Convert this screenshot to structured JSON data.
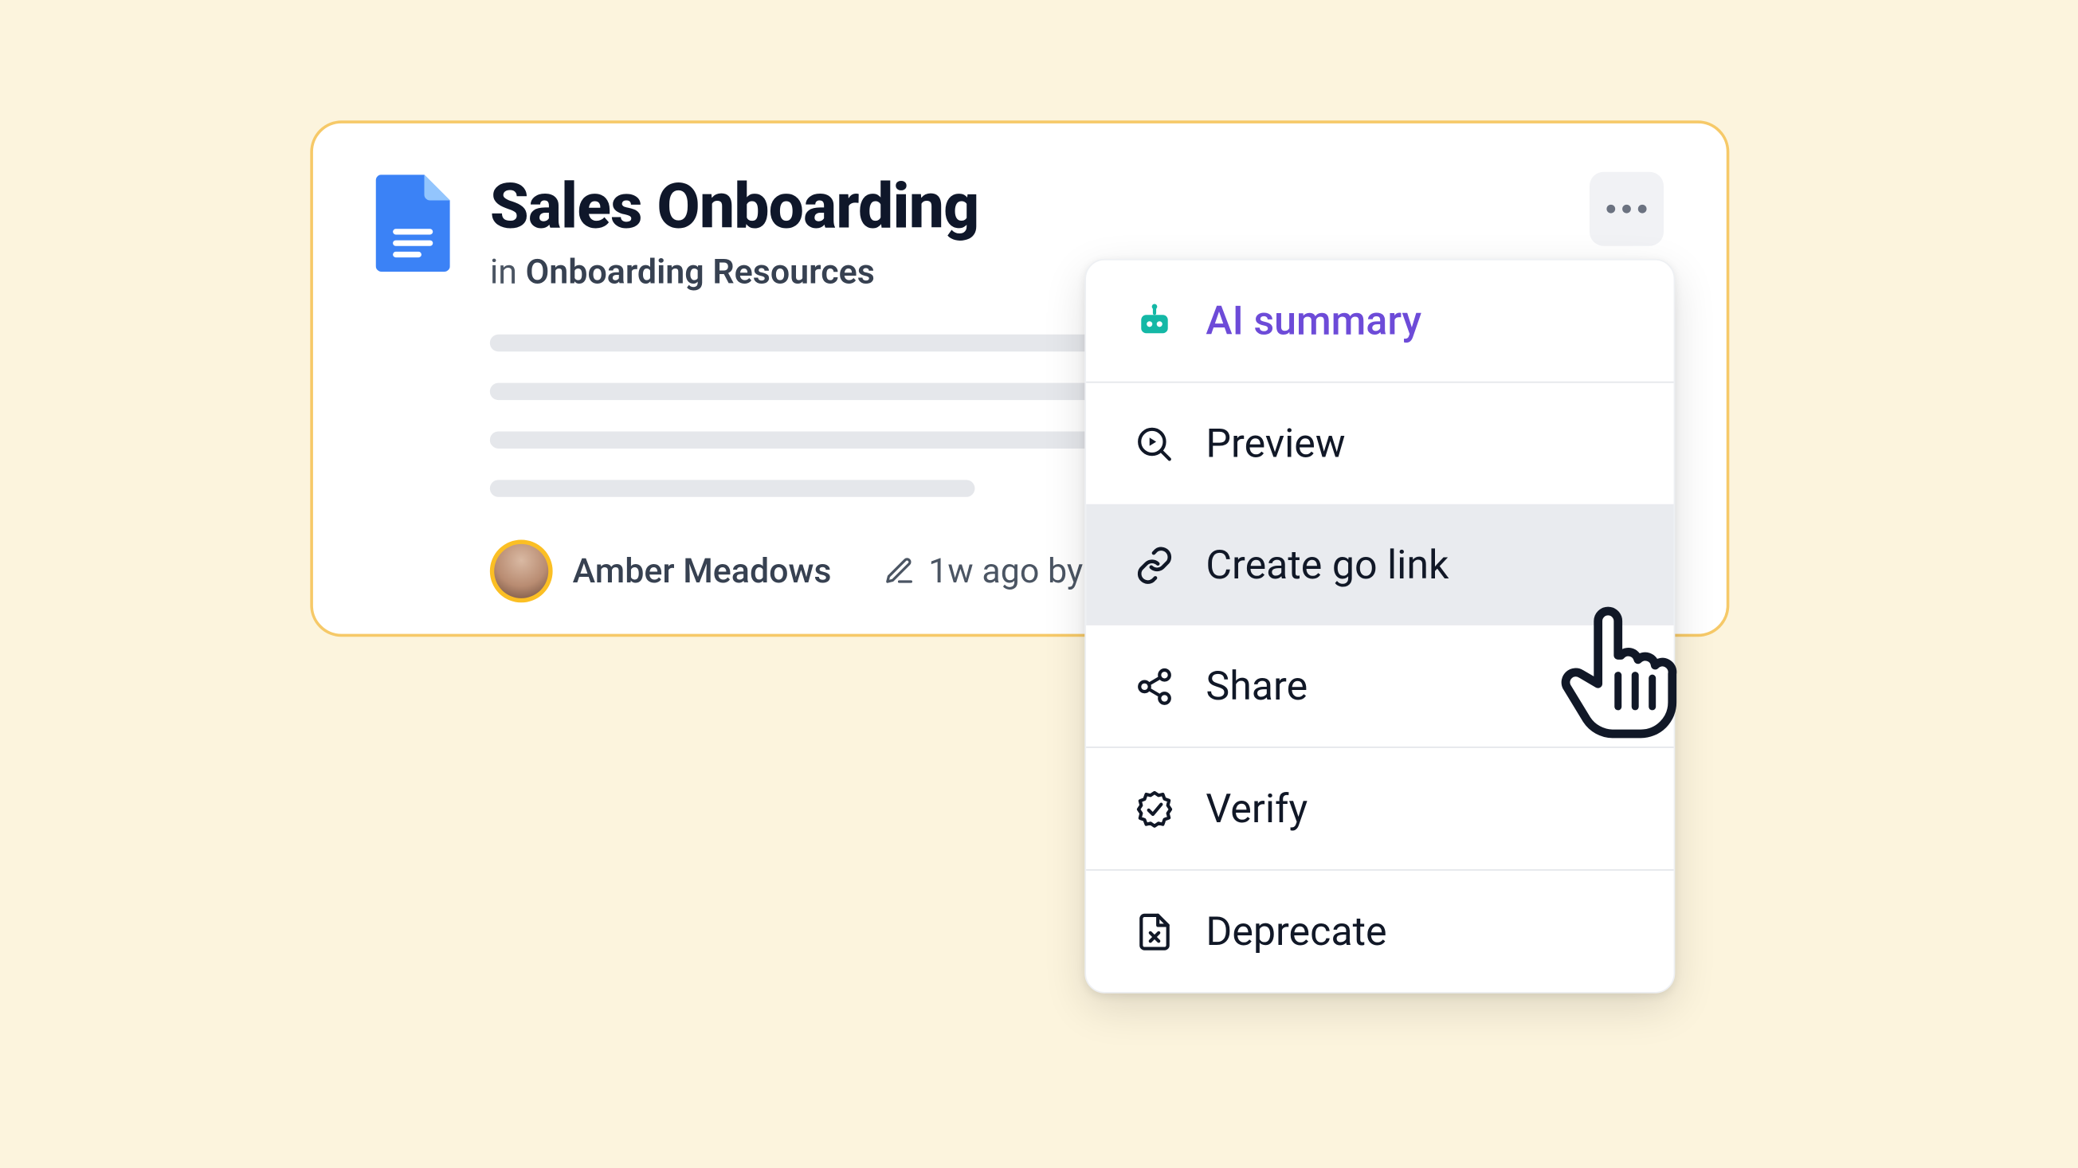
{
  "card": {
    "title": "Sales Onboarding",
    "location_prefix": "in",
    "location_folder": "Onboarding Resources",
    "author": "Amber Meadows",
    "edited_prefix": "1w ago by"
  },
  "icons": {
    "doc_icon": "google-doc-icon",
    "more_icon": "more-horizontal-icon",
    "pencil_icon": "pencil-icon",
    "robot_icon": "robot-icon",
    "preview_icon": "magnify-play-icon",
    "link_icon": "link-icon",
    "share_icon": "share-nodes-icon",
    "verify_icon": "verified-badge-icon",
    "deprecate_icon": "file-x-icon",
    "cursor_icon": "hand-pointer-icon"
  },
  "menu": {
    "items": [
      {
        "label": "AI summary",
        "highlight": "ai"
      },
      {
        "label": "Preview",
        "highlight": ""
      },
      {
        "label": "Create go link",
        "highlight": "hovered"
      },
      {
        "label": "Share",
        "highlight": ""
      },
      {
        "label": "Verify",
        "highlight": ""
      },
      {
        "label": "Deprecate",
        "highlight": ""
      }
    ]
  },
  "colors": {
    "page_bg": "#fcf4dd",
    "card_border": "#f6c968",
    "ai_label": "#6d4bd8",
    "doc_primary": "#3b82f6",
    "text_primary": "#0f172a",
    "text_secondary": "#4b5563",
    "menu_hover_bg": "#e9ebef"
  }
}
